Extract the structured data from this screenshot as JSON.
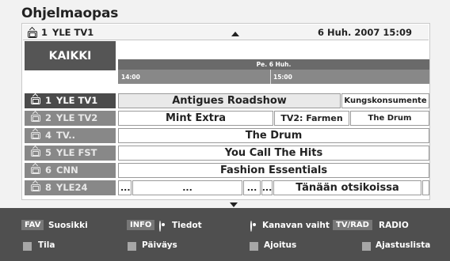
{
  "app": {
    "title": "Ohjelmaopas"
  },
  "info_bar": {
    "channel_number": "1",
    "channel_name": "YLE TV1",
    "datetime": "6 Huh. 2007 15:09"
  },
  "filter": {
    "label": "KAIKKI"
  },
  "timeline": {
    "date": "Pe. 6 Huh.",
    "times": [
      "14:00",
      "15:00"
    ]
  },
  "channels": [
    {
      "number": "1",
      "name": "YLE TV1"
    },
    {
      "number": "2",
      "name": "YLE TV2"
    },
    {
      "number": "4",
      "name": "TV.."
    },
    {
      "number": "5",
      "name": "YLE FST"
    },
    {
      "number": "6",
      "name": "CNN"
    },
    {
      "number": "8",
      "name": "YLE24"
    }
  ],
  "programs": {
    "row1": [
      "Antigues Roadshow",
      "Kungskonsumente"
    ],
    "row2": [
      "Mint Extra",
      "TV2: Farmen",
      "The Drum"
    ],
    "row3": [
      "The Drum"
    ],
    "row4": [
      "You Call The Hits"
    ],
    "row5": [
      "Fashion Essentials"
    ],
    "row6": [
      "...",
      "...",
      "...",
      "...",
      "Tänään otsikoissa"
    ]
  },
  "footer": {
    "fav_key": "FAV",
    "fav_label": "Suosikki",
    "info_key": "INFO",
    "info_label": "Tiedot",
    "switch_label": "Kanavan vaiht",
    "tvrad_key": "TV/RAD",
    "radio_label": "RADIO",
    "tila_label": "Tila",
    "paivays_label": "Päiväys",
    "ajoitus_label": "Ajoitus",
    "ajastuslista_label": "Ajastuslista"
  },
  "colors": {
    "panel_bg": "#ffffff",
    "selected_row": "#4b4b4b",
    "channel_row": "#888888",
    "footer_bg": "#4f4f4f"
  }
}
